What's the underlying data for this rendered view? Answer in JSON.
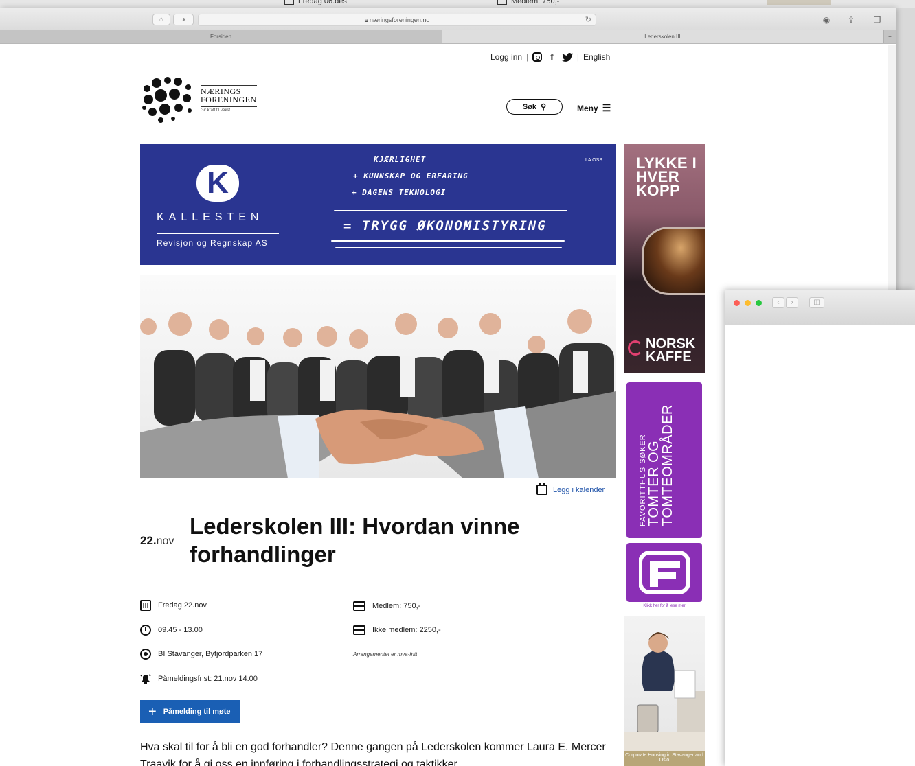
{
  "bg_window": {
    "date": "Fredag 06.des",
    "member": "Medlem: 750,-"
  },
  "browser": {
    "url": "næringsforeningen.no",
    "tabs": [
      "Forsiden",
      "Lederskolen III"
    ]
  },
  "topnav": {
    "login": "Logg inn",
    "english": "English"
  },
  "logo": {
    "line1": "NÆRINGS",
    "line2": "FORENINGEN",
    "tagline": "Gir kraft til vekst"
  },
  "header": {
    "search": "Søk",
    "menu": "Meny"
  },
  "banner": {
    "brand": "KALLESTEN",
    "sub": "Revisjon og Regnskap AS",
    "lines": [
      "KJÆRLIGHET",
      "+ KUNNSKAP OG ERFARING",
      "+ DAGENS TEKNOLOGI",
      "= TRYGG ØKONOMISTYRING"
    ],
    "corner": "LA OSS"
  },
  "calendar_link": "Legg i kalender",
  "event": {
    "day": "22.",
    "month": "nov",
    "title": "Lederskolen III: Hvordan vinne forhandlinger",
    "date": "Fredag 22.nov",
    "time": "09.45 - 13.00",
    "place": "BI Stavanger, Byfjordparken 17",
    "deadline": "Påmeldingsfrist: 21.nov 14.00",
    "price_member": "Medlem: 750,-",
    "price_nonmember": "Ikke medlem: 2250,-",
    "note": "Arrangementet er mva-fritt",
    "signup": "Påmelding til møte",
    "intro": "Hva skal til for å bli en god forhandler? Denne gangen på Lederskolen kommer Laura E. Mercer Traavik for å gi oss en innføring i forhandlingsstrategi og taktikker."
  },
  "ads": {
    "coffee_title": "LYKKE I HVER KOPP",
    "coffee_brand": "NORSK KAFFE",
    "favoritthus_small": "FAVORITTHUS SØKER",
    "favoritthus_big": "TOMTER OG TOMTEOMRÅDER",
    "f_caption": "Klikk her for å lese mer",
    "corporate_caption": "Corporate Housing in Stavanger and Oslo"
  },
  "colors": {
    "banner": "#2a3591",
    "accent": "#1a5fb4",
    "ad_purple": "#8a2fb5"
  }
}
